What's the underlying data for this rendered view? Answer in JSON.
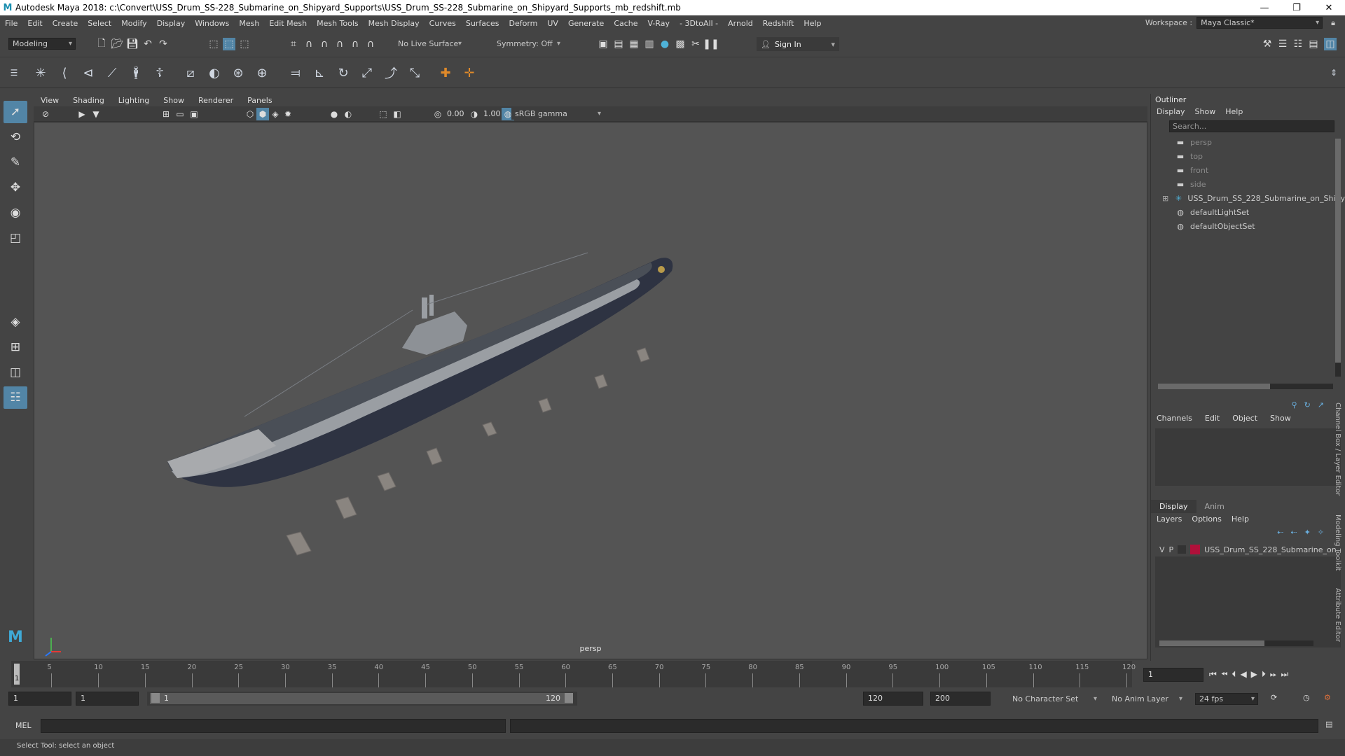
{
  "titlebar": {
    "title": "Autodesk Maya 2018: c:\\Convert\\USS_Drum_SS-228_Submarine_on_Shipyard_Supports\\USS_Drum_SS-228_Submarine_on_Shipyard_Supports_mb_redshift.mb",
    "minimize": "—",
    "maximize": "❐",
    "close": "✕"
  },
  "menu": [
    "File",
    "Edit",
    "Create",
    "Select",
    "Modify",
    "Display",
    "Windows",
    "Mesh",
    "Edit Mesh",
    "Mesh Tools",
    "Mesh Display",
    "Curves",
    "Surfaces",
    "Deform",
    "UV",
    "Generate",
    "Cache",
    "V-Ray",
    "- 3DtoAll -",
    "Arnold",
    "Redshift",
    "Help"
  ],
  "workspace": {
    "label": "Workspace :",
    "value": "Maya Classic*"
  },
  "statusline": {
    "mode": "Modeling",
    "live_surface": "No Live Surface",
    "symmetry": "Symmetry: Off",
    "sign_in": "Sign In"
  },
  "panel_menu": [
    "View",
    "Shading",
    "Lighting",
    "Show",
    "Renderer",
    "Panels"
  ],
  "panel_bar": {
    "exposure": "0.00",
    "gamma": "1.00",
    "color_space": "sRGB gamma"
  },
  "viewport": {
    "camera_label": "persp"
  },
  "outliner": {
    "title": "Outliner",
    "menu": [
      "Display",
      "Show",
      "Help"
    ],
    "search_placeholder": "Search...",
    "items": [
      {
        "label": "persp",
        "icon": "camera-icon",
        "dim": true
      },
      {
        "label": "top",
        "icon": "camera-icon",
        "dim": true
      },
      {
        "label": "front",
        "icon": "camera-icon",
        "dim": true
      },
      {
        "label": "side",
        "icon": "camera-icon",
        "dim": true
      },
      {
        "label": "USS_Drum_SS_228_Submarine_on_Shipy",
        "icon": "group-icon",
        "dim": false
      },
      {
        "label": "defaultLightSet",
        "icon": "set-icon",
        "dim": false
      },
      {
        "label": "defaultObjectSet",
        "icon": "set-icon",
        "dim": false
      }
    ]
  },
  "channelbox": {
    "menu": [
      "Channels",
      "Edit",
      "Object",
      "Show"
    ]
  },
  "layereditor": {
    "tabs": [
      "Display",
      "Anim"
    ],
    "menu": [
      "Layers",
      "Options",
      "Help"
    ],
    "layer": {
      "v": "V",
      "p": "P",
      "name": "USS_Drum_SS_228_Submarine_on",
      "color": "#b0103a"
    }
  },
  "side_tabs": [
    "Channel Box / Layer Editor",
    "Modeling Toolkit",
    "Attribute Editor"
  ],
  "timeline": {
    "ticks": [
      "5",
      "10",
      "15",
      "20",
      "25",
      "30",
      "35",
      "40",
      "45",
      "50",
      "55",
      "60",
      "65",
      "70",
      "75",
      "80",
      "85",
      "90",
      "95",
      "100",
      "105",
      "110",
      "115",
      "120"
    ],
    "current_frame": "1",
    "frame_field": "1"
  },
  "range": {
    "start": "1",
    "start2": "1",
    "slider_start": "1",
    "slider_end": "120",
    "end": "120",
    "end2": "200",
    "character_set": "No Character Set",
    "anim_layer": "No Anim Layer",
    "fps": "24 fps"
  },
  "cmdline": {
    "label": "MEL"
  },
  "helpline": {
    "text": "Select Tool: select an object"
  }
}
